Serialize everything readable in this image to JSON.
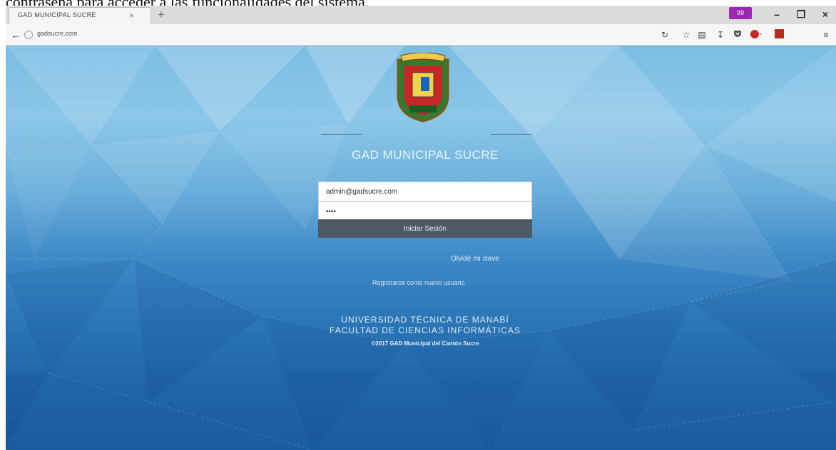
{
  "caption": "contraseña para acceder a las funcionalidades del sistema.",
  "browser": {
    "tab_title": "GAD MUNICIPAL SUCRE",
    "tab_close": "×",
    "new_tab": "+",
    "badge": "99",
    "url": "gadsucre.com",
    "window_controls": {
      "minimize": "–",
      "restore": "❐",
      "close": "×"
    },
    "icons": [
      "reload-icon",
      "star-icon",
      "reading-list-icon",
      "download-icon",
      "pocket-icon",
      "adblock-icon",
      "extension-icon",
      "menu-icon"
    ]
  },
  "login": {
    "organization": "GAD MUNICIPAL SUCRE",
    "email_value": "admin@gadsucre.com",
    "password_value": "••••",
    "submit_label": "Iniciar Sesión",
    "forgot_password": "Olvidé mi clave",
    "register_text": "Registrarse como nuevo usuario"
  },
  "footer": {
    "line1": "UNIVERSIDAD TÉCNICA DE MANABÍ",
    "line2": "FACULTAD DE CIENCIAS INFORMÁTICAS",
    "copyright": "©2017 GAD Municipal del Cantón Sucre"
  },
  "colors": {
    "accent_purple": "#9c27b0",
    "button_bg": "#4d5a66",
    "bg_light_blue": "#8cc7e8",
    "bg_dark_blue": "#1b5c9f"
  }
}
